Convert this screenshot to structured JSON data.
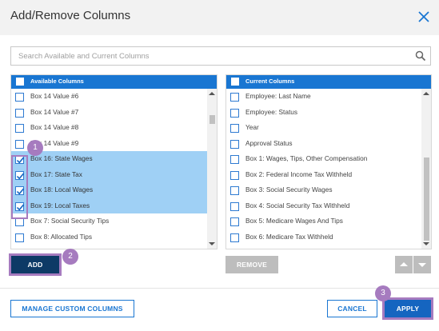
{
  "dialog": {
    "title": "Add/Remove Columns"
  },
  "search": {
    "placeholder": "Search Available and Current Columns"
  },
  "available": {
    "header": "Available Columns",
    "items": [
      {
        "label": "Box 14 Value #6",
        "checked": false,
        "selected": false
      },
      {
        "label": "Box 14 Value #7",
        "checked": false,
        "selected": false
      },
      {
        "label": "Box 14 Value #8",
        "checked": false,
        "selected": false
      },
      {
        "label": "Box 14 Value #9",
        "checked": false,
        "selected": false
      },
      {
        "label": "Box 16: State Wages",
        "checked": true,
        "selected": true
      },
      {
        "label": "Box 17: State Tax",
        "checked": true,
        "selected": true
      },
      {
        "label": "Box 18: Local Wages",
        "checked": true,
        "selected": true
      },
      {
        "label": "Box 19: Local Taxes",
        "checked": true,
        "selected": true
      },
      {
        "label": "Box 7: Social Security Tips",
        "checked": false,
        "selected": false
      },
      {
        "label": "Box 8: Allocated Tips",
        "checked": false,
        "selected": false
      }
    ]
  },
  "current": {
    "header": "Current Columns",
    "items": [
      {
        "label": "Employee: Last Name",
        "checked": false
      },
      {
        "label": "Employee: Status",
        "checked": false
      },
      {
        "label": "Year",
        "checked": false
      },
      {
        "label": "Approval Status",
        "checked": false
      },
      {
        "label": "Box 1: Wages, Tips, Other Compensation",
        "checked": false
      },
      {
        "label": "Box 2: Federal Income Tax Withheld",
        "checked": false
      },
      {
        "label": "Box 3: Social Security Wages",
        "checked": false
      },
      {
        "label": "Box 4: Social Security Tax Withheld",
        "checked": false
      },
      {
        "label": "Box 5: Medicare Wages And Tips",
        "checked": false
      },
      {
        "label": "Box 6: Medicare Tax Withheld",
        "checked": false
      }
    ]
  },
  "buttons": {
    "add": "ADD",
    "remove": "REMOVE",
    "manage": "MANAGE CUSTOM COLUMNS",
    "cancel": "CANCEL",
    "apply": "APPLY"
  },
  "annotations": {
    "step1": "1",
    "step2": "2",
    "step3": "3"
  },
  "colors": {
    "primary": "#1976d2",
    "selected_row": "#9fd0f5",
    "annotation": "#a67bbf"
  }
}
